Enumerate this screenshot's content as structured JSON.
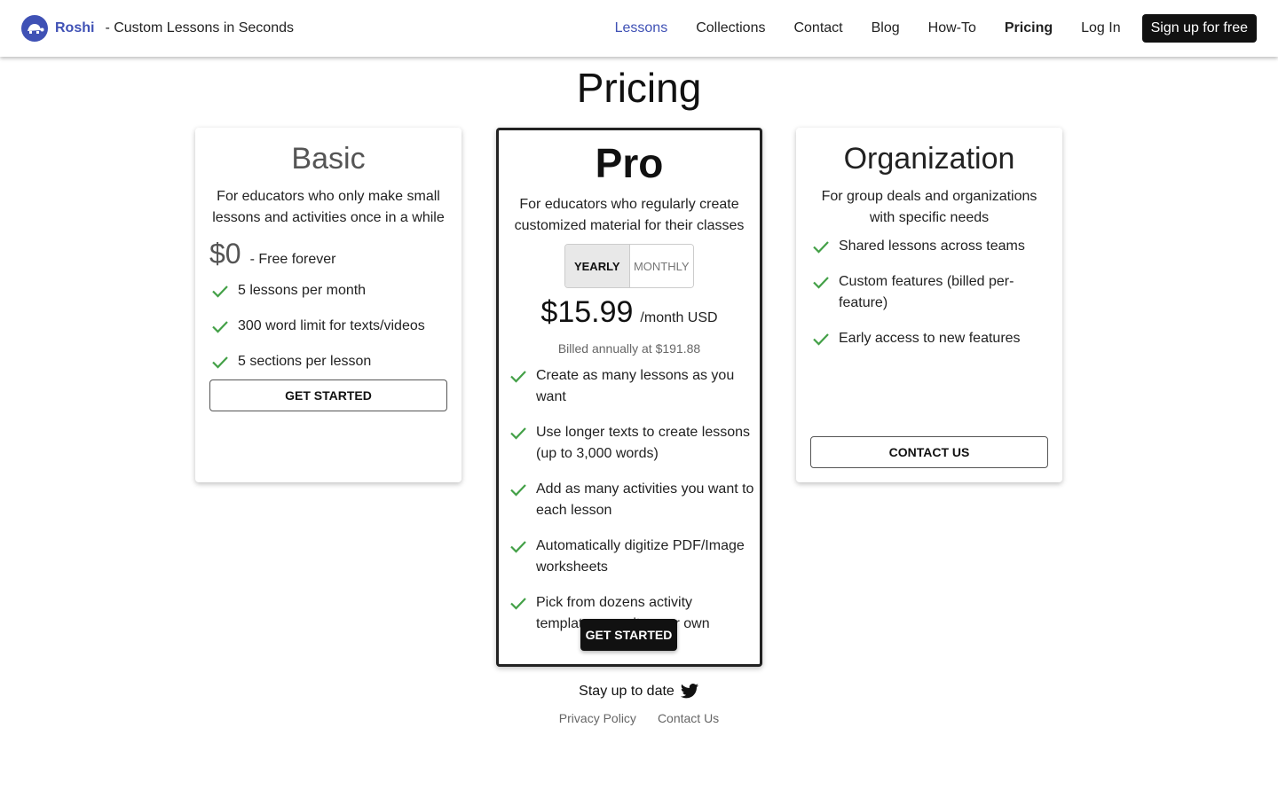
{
  "header": {
    "brand_name": "Roshi",
    "tagline": "- Custom Lessons in Seconds",
    "nav": [
      "Lessons",
      "Collections",
      "Contact",
      "Blog",
      "How-To",
      "Pricing",
      "Log In"
    ],
    "active_nav": "Lessons",
    "current_page_nav": "Pricing",
    "signup_label": "Sign up for free"
  },
  "page_title": "Pricing",
  "plans": {
    "basic": {
      "title": "Basic",
      "description": "For educators who only make small lessons and activities once in a while",
      "price": "$0",
      "price_note": "- Free forever",
      "features": [
        "5 lessons per month",
        "300 word limit for texts/videos",
        "5 sections per lesson"
      ],
      "button_label": "Get started"
    },
    "pro": {
      "title": "Pro",
      "description": "For educators who regularly create customized material for their classes",
      "billing_options": [
        "Yearly",
        "Monthly"
      ],
      "selected_billing": "Yearly",
      "price": "$15.99",
      "price_unit": "/month USD",
      "billed_note": "Billed annually at $191.88",
      "features": [
        "Create as many lessons as you want",
        "Use longer texts to create lessons (up to 3,000 words)",
        "Add as many activities you want to each lesson",
        "Automatically digitize PDF/Image worksheets",
        "Pick from dozens activity templates or write your own"
      ],
      "button_label": "Get started"
    },
    "organization": {
      "title": "Organization",
      "description": "For group deals and organizations with specific needs",
      "features": [
        "Shared lessons across teams",
        "Custom features (billed per-feature)",
        "Early access to new features"
      ],
      "button_label": "Contact us"
    }
  },
  "footer": {
    "stay_label": "Stay up to date",
    "links": [
      "Privacy Policy",
      "Contact Us"
    ]
  },
  "colors": {
    "brand": "#3f51b5",
    "check": "#43a047",
    "dark_button": "#111111"
  },
  "icons": {
    "logo": "turtle-logo-icon",
    "feature": "check-icon",
    "social": "twitter-icon"
  }
}
